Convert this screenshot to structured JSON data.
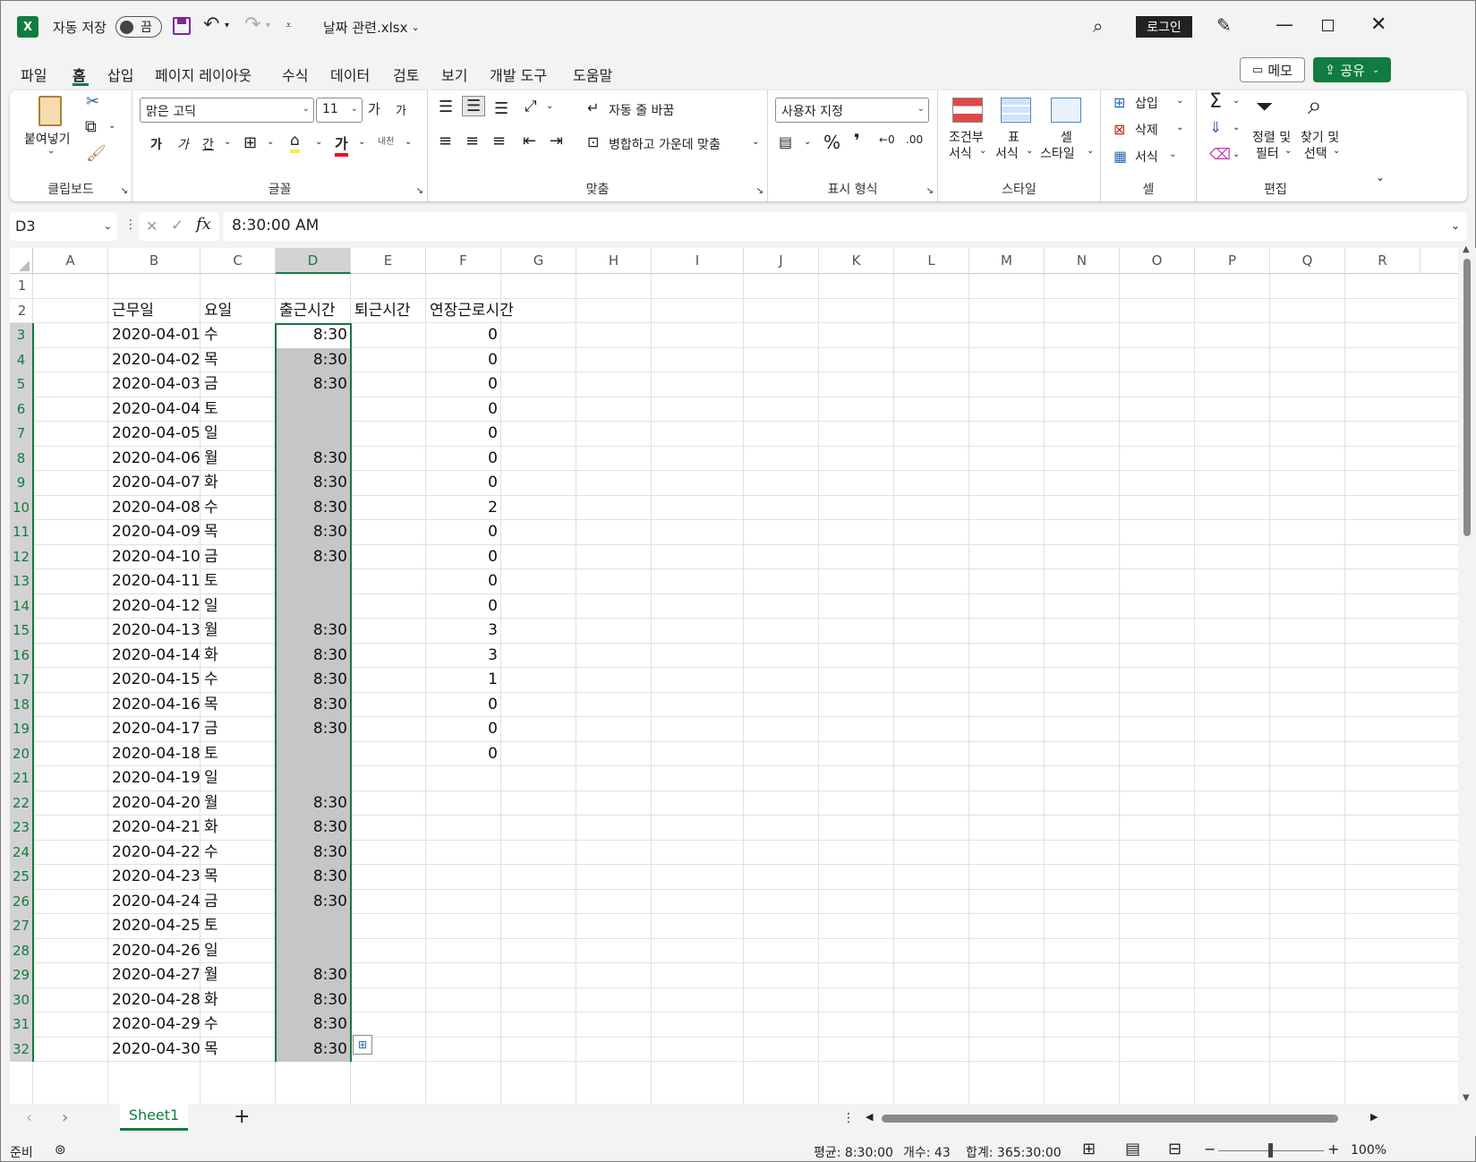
{
  "titlebar": {
    "autosave_label": "자동 저장",
    "autosave_state": "끔",
    "filename": "날짜 관련.xlsx",
    "login": "로그인"
  },
  "tabs": [
    "파일",
    "홈",
    "삽입",
    "페이지 레이아웃",
    "수식",
    "데이터",
    "검토",
    "보기",
    "개발 도구",
    "도움말"
  ],
  "active_tab": "홈",
  "memo_button": "메모",
  "share_button": "공유",
  "ribbon": {
    "clipboard": {
      "paste": "붙여넣기",
      "label": "클립보드"
    },
    "font": {
      "font_name": "맑은 고딕",
      "font_size": "11",
      "label": "글꼴",
      "bold": "가",
      "italic": "가",
      "underline": "간",
      "grow": "가",
      "shrink": "가",
      "color_a": "가",
      "phonetic": "내천"
    },
    "align": {
      "wrap": "자동 줄 바꿈",
      "merge": "병합하고 가운데 맞춤",
      "label": "맞춤"
    },
    "number": {
      "format": "사용자 지정",
      "label": "표시 형식"
    },
    "styles": {
      "cond_a": "조건부",
      "cond_b": "서식",
      "table_a": "표",
      "table_b": "서식",
      "cell_a": "셀",
      "cell_b": "스타일",
      "label": "스타일"
    },
    "cells": {
      "insert": "삽입",
      "delete": "삭제",
      "format": "서식",
      "label": "셀"
    },
    "edit": {
      "sort_a": "정렬 및",
      "sort_b": "필터",
      "find_a": "찾기 및",
      "find_b": "선택",
      "label": "편집"
    }
  },
  "formula_bar": {
    "name_box": "D3",
    "formula": "8:30:00 AM",
    "fx": "fx"
  },
  "columns": [
    "A",
    "B",
    "C",
    "D",
    "E",
    "F",
    "G",
    "H",
    "I",
    "J",
    "K",
    "L",
    "M",
    "N",
    "O",
    "P",
    "Q",
    "R"
  ],
  "headers": {
    "b": "근무일",
    "c": "요일",
    "d": "출근시간",
    "e": "퇴근시간",
    "f": "연장근로시간"
  },
  "rows": [
    {
      "n": "1",
      "b": "",
      "c": "",
      "d": "",
      "f": ""
    },
    {
      "n": "2",
      "b": "",
      "c": "",
      "d": "",
      "f": ""
    },
    {
      "n": "3",
      "b": "2020-04-01",
      "c": "수",
      "d": "8:30",
      "f": "0"
    },
    {
      "n": "4",
      "b": "2020-04-02",
      "c": "목",
      "d": "8:30",
      "f": "0"
    },
    {
      "n": "5",
      "b": "2020-04-03",
      "c": "금",
      "d": "8:30",
      "f": "0"
    },
    {
      "n": "6",
      "b": "2020-04-04",
      "c": "토",
      "d": "",
      "f": "0"
    },
    {
      "n": "7",
      "b": "2020-04-05",
      "c": "일",
      "d": "",
      "f": "0"
    },
    {
      "n": "8",
      "b": "2020-04-06",
      "c": "월",
      "d": "8:30",
      "f": "0"
    },
    {
      "n": "9",
      "b": "2020-04-07",
      "c": "화",
      "d": "8:30",
      "f": "0"
    },
    {
      "n": "10",
      "b": "2020-04-08",
      "c": "수",
      "d": "8:30",
      "f": "2"
    },
    {
      "n": "11",
      "b": "2020-04-09",
      "c": "목",
      "d": "8:30",
      "f": "0"
    },
    {
      "n": "12",
      "b": "2020-04-10",
      "c": "금",
      "d": "8:30",
      "f": "0"
    },
    {
      "n": "13",
      "b": "2020-04-11",
      "c": "토",
      "d": "",
      "f": "0"
    },
    {
      "n": "14",
      "b": "2020-04-12",
      "c": "일",
      "d": "",
      "f": "0"
    },
    {
      "n": "15",
      "b": "2020-04-13",
      "c": "월",
      "d": "8:30",
      "f": "3"
    },
    {
      "n": "16",
      "b": "2020-04-14",
      "c": "화",
      "d": "8:30",
      "f": "3"
    },
    {
      "n": "17",
      "b": "2020-04-15",
      "c": "수",
      "d": "8:30",
      "f": "1"
    },
    {
      "n": "18",
      "b": "2020-04-16",
      "c": "목",
      "d": "8:30",
      "f": "0"
    },
    {
      "n": "19",
      "b": "2020-04-17",
      "c": "금",
      "d": "8:30",
      "f": "0"
    },
    {
      "n": "20",
      "b": "2020-04-18",
      "c": "토",
      "d": "",
      "f": "0"
    },
    {
      "n": "21",
      "b": "2020-04-19",
      "c": "일",
      "d": "",
      "f": ""
    },
    {
      "n": "22",
      "b": "2020-04-20",
      "c": "월",
      "d": "8:30",
      "f": ""
    },
    {
      "n": "23",
      "b": "2020-04-21",
      "c": "화",
      "d": "8:30",
      "f": ""
    },
    {
      "n": "24",
      "b": "2020-04-22",
      "c": "수",
      "d": "8:30",
      "f": ""
    },
    {
      "n": "25",
      "b": "2020-04-23",
      "c": "목",
      "d": "8:30",
      "f": ""
    },
    {
      "n": "26",
      "b": "2020-04-24",
      "c": "금",
      "d": "8:30",
      "f": ""
    },
    {
      "n": "27",
      "b": "2020-04-25",
      "c": "토",
      "d": "",
      "f": ""
    },
    {
      "n": "28",
      "b": "2020-04-26",
      "c": "일",
      "d": "",
      "f": ""
    },
    {
      "n": "29",
      "b": "2020-04-27",
      "c": "월",
      "d": "8:30",
      "f": ""
    },
    {
      "n": "30",
      "b": "2020-04-28",
      "c": "화",
      "d": "8:30",
      "f": ""
    },
    {
      "n": "31",
      "b": "2020-04-29",
      "c": "수",
      "d": "8:30",
      "f": ""
    },
    {
      "n": "32",
      "b": "2020-04-30",
      "c": "목",
      "d": "8:30",
      "f": ""
    }
  ],
  "sheet_tab": "Sheet1",
  "status": {
    "ready": "준비",
    "average": "평균: 8:30:00",
    "count": "개수: 43",
    "sum": "합계: 365:30:00",
    "zoom": "100%"
  },
  "colors": {
    "excel_green": "#107c41",
    "selection_fill": "#c6c6c6",
    "selection_border": "#217346"
  }
}
